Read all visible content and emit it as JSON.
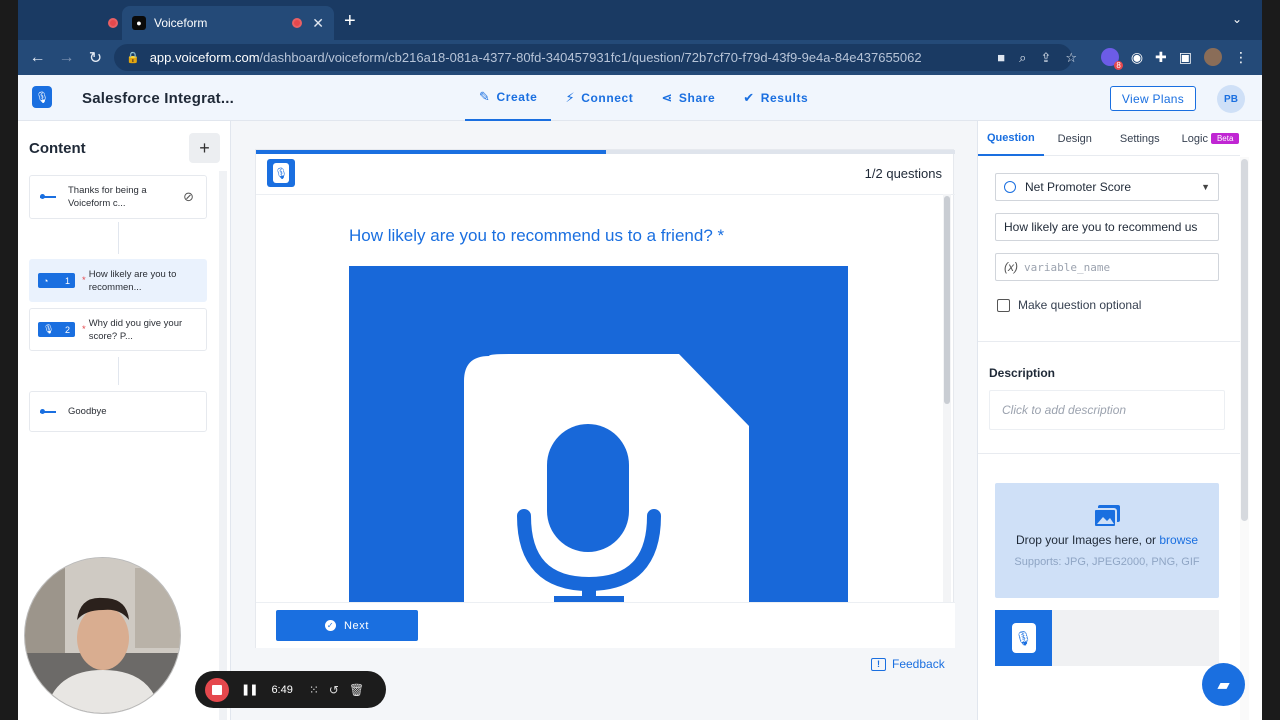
{
  "browser": {
    "active_tab_title": "Voiceform",
    "url_host": "app.voiceform.com",
    "url_path": "/dashboard/voiceform/cb216a18-081a-4377-80fd-340457931fc1/question/72b7cf70-f79d-43f9-9e4a-84e437655062",
    "extension_badge": "8",
    "new_tab": "+",
    "close_tab": "✕"
  },
  "app": {
    "form_title": "Salesforce Integrat...",
    "nav": [
      {
        "label": "Create",
        "icon": "pencil-icon"
      },
      {
        "label": "Connect",
        "icon": "plug-icon"
      },
      {
        "label": "Share",
        "icon": "share-icon"
      },
      {
        "label": "Results",
        "icon": "checks-icon"
      }
    ],
    "view_plans": "View Plans",
    "user_initials": "PB"
  },
  "content": {
    "title": "Content",
    "add": "+",
    "welcome": "Thanks for being a Voiceform c...",
    "questions": [
      {
        "num": "1",
        "text": "How likely are you to recommen..."
      },
      {
        "num": "2",
        "text": "Why did you give your score? P..."
      }
    ],
    "goodbye": "Goodbye"
  },
  "preview": {
    "progress": 0.5,
    "count": "1/2 questions",
    "question": "How likely are you to recommend us to a friend? *",
    "next": "Next",
    "feedback": "Feedback"
  },
  "panel": {
    "tabs": [
      "Question",
      "Design",
      "Settings",
      "Logic"
    ],
    "beta": "Beta",
    "question_type": "Net Promoter Score",
    "question_text": "How likely are you to recommend us",
    "variable_prefix": "(x)",
    "variable_placeholder": "variable_name",
    "optional_label": "Make question optional",
    "description_label": "Description",
    "description_placeholder": "Click to add description",
    "drop_text": "Drop your Images here, or",
    "drop_link": "browse",
    "supports": "Supports: JPG, JPEG2000, PNG, GIF"
  },
  "recorder": {
    "time": "6:49"
  },
  "colors": {
    "accent": "#1a6fe0",
    "record": "#e5484d",
    "beta": "#c026d3"
  }
}
